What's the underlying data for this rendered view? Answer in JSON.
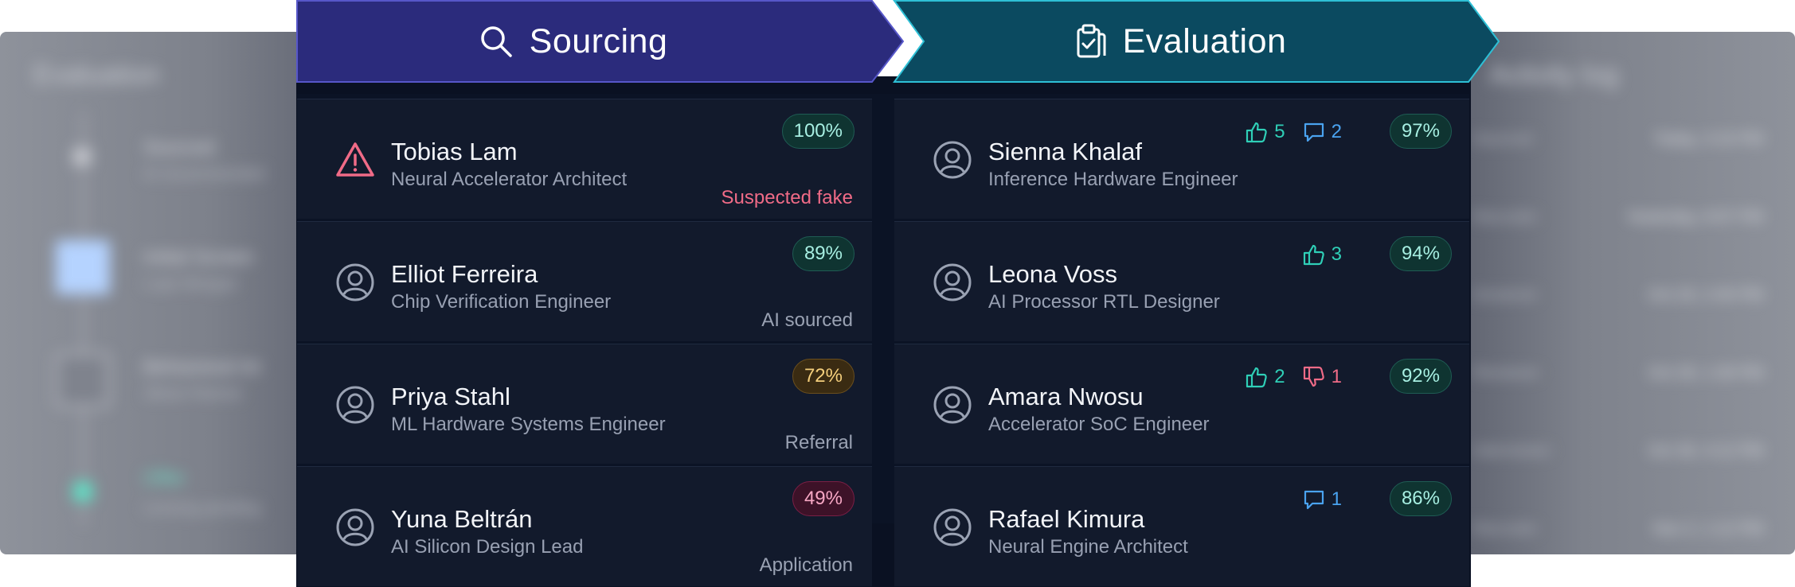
{
  "background": {
    "left_panel": {
      "title": "Evaluation",
      "rows": [
        {
          "line1": "Sourced",
          "line2": "AI recommended"
        },
        {
          "line1": "Initial Screen",
          "line2": "Lupe Morgan"
        },
        {
          "line1": "Behavioral Int",
          "line2": "Jibran Ramos"
        },
        {
          "line1": "Offer",
          "line2": "Lensing pending"
        }
      ]
    },
    "right_panel": {
      "title": "Activity log",
      "rows": [
        {
          "who": "Sourced",
          "when": "Today, 3:15 PM"
        },
        {
          "who": "Recruiter",
          "when": "Yesterday, 9:07 PM"
        },
        {
          "who": "Screener",
          "when": "Oct 20, 2:45 PM"
        },
        {
          "who": "Reviewer",
          "when": "Oct 28, 1:30 PM"
        },
        {
          "who": "Interviewer",
          "when": "Oct 30, 4:12 PM"
        },
        {
          "who": "Recruiter",
          "when": "Nov 2, 1:12 PM"
        }
      ]
    }
  },
  "stages": {
    "sourcing": {
      "title": "Sourcing",
      "icon": "search-icon",
      "color": "#2b2b7c",
      "candidates": [
        {
          "name": "Tobias Lam",
          "role": "Neural Accelerator Architect",
          "score": "100%",
          "score_tone": "green",
          "source": "Suspected fake",
          "warning": true
        },
        {
          "name": "Elliot Ferreira",
          "role": "Chip Verification Engineer",
          "score": "89%",
          "score_tone": "green",
          "source": "AI sourced",
          "warning": false
        },
        {
          "name": "Priya Stahl",
          "role": "ML Hardware Systems Engineer",
          "score": "72%",
          "score_tone": "amber",
          "source": "Referral",
          "warning": false
        },
        {
          "name": "Yuna Beltrán",
          "role": "AI Silicon Design Lead",
          "score": "49%",
          "score_tone": "red",
          "source": "Application",
          "warning": false
        }
      ]
    },
    "evaluation": {
      "title": "Evaluation",
      "icon": "clipboard-check-icon",
      "color": "#0b4a60",
      "candidates": [
        {
          "name": "Sienna Khalaf",
          "role": "Inference Hardware Engineer",
          "score": "97%",
          "thumbs_up": "5",
          "comments": "2"
        },
        {
          "name": "Leona Voss",
          "role": "AI Processor RTL Designer",
          "score": "94%",
          "thumbs_up": "3"
        },
        {
          "name": "Amara Nwosu",
          "role": "Accelerator SoC Engineer",
          "score": "92%",
          "thumbs_up": "2",
          "thumbs_down": "1"
        },
        {
          "name": "Rafael Kimura",
          "role": "Neural Engine Architect",
          "score": "86%",
          "comments": "1"
        }
      ]
    }
  }
}
